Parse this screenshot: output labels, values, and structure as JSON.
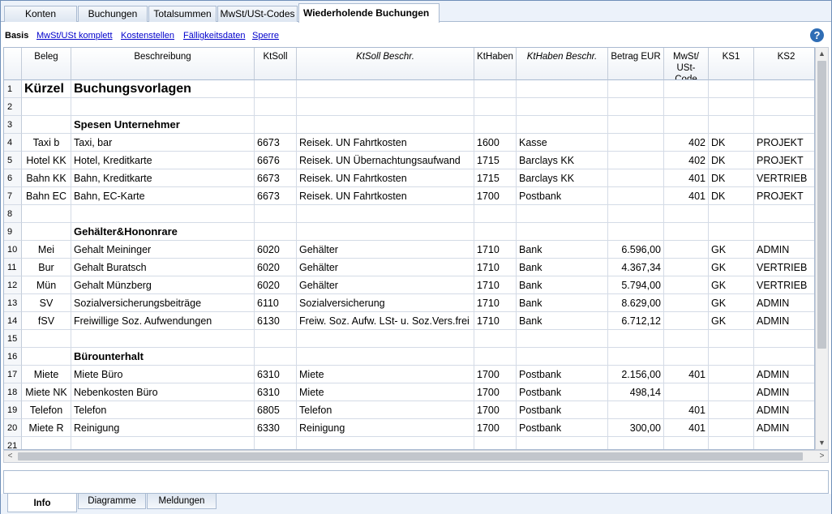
{
  "tabs": [
    {
      "label": "Konten",
      "active": false
    },
    {
      "label": "Buchungen",
      "active": false
    },
    {
      "label": "Totalsummen",
      "active": false
    },
    {
      "label": "MwSt/USt-Codes",
      "active": false
    },
    {
      "label": "Wiederholende Buchungen",
      "active": true,
      "close_glyph": "✕"
    }
  ],
  "views": [
    "Basis",
    "MwSt/USt komplett",
    "Kostenstellen",
    "Fälligkeitsdaten",
    "Sperre"
  ],
  "help_glyph": "?",
  "columns": [
    {
      "label": "Beleg",
      "italic": false
    },
    {
      "label": "Beschreibung",
      "italic": false
    },
    {
      "label": "KtSoll",
      "italic": false
    },
    {
      "label": "KtSoll Beschr.",
      "italic": true
    },
    {
      "label": "KtHaben",
      "italic": false
    },
    {
      "label": "KtHaben Beschr.",
      "italic": true
    },
    {
      "label": "Betrag EUR",
      "italic": false
    },
    {
      "label": "MwSt/\nUSt-Code",
      "italic": false
    },
    {
      "label": "KS1",
      "italic": false
    },
    {
      "label": "KS2",
      "italic": false
    }
  ],
  "rows": [
    {
      "n": "1",
      "type": "title",
      "cells": [
        "Kürzel",
        "Buchungsvorlagen",
        "",
        "",
        "",
        "",
        "",
        "",
        "",
        ""
      ]
    },
    {
      "n": "2",
      "type": "empty",
      "cells": [
        "",
        "",
        "",
        "",
        "",
        "",
        "",
        "",
        "",
        ""
      ]
    },
    {
      "n": "3",
      "type": "section",
      "cells": [
        "",
        "Spesen Unternehmer",
        "",
        "",
        "",
        "",
        "",
        "",
        "",
        ""
      ]
    },
    {
      "n": "4",
      "type": "data",
      "cells": [
        "Taxi b",
        "Taxi, bar",
        "6673",
        "Reisek. UN Fahrtkosten",
        "1600",
        "Kasse",
        "",
        "402",
        "DK",
        "PROJEKT"
      ]
    },
    {
      "n": "5",
      "type": "data",
      "cells": [
        "Hotel KK",
        "Hotel, Kreditkarte",
        "6676",
        "Reisek. UN Übernachtungsaufwand",
        "1715",
        "Barclays KK",
        "",
        "402",
        "DK",
        "PROJEKT"
      ]
    },
    {
      "n": "6",
      "type": "data",
      "cells": [
        "Bahn KK",
        "Bahn, Kreditkarte",
        "6673",
        "Reisek. UN Fahrtkosten",
        "1715",
        "Barclays KK",
        "",
        "401",
        "DK",
        "VERTRIEB"
      ]
    },
    {
      "n": "7",
      "type": "data",
      "cells": [
        "Bahn EC",
        "Bahn, EC-Karte",
        "6673",
        "Reisek. UN Fahrtkosten",
        "1700",
        "Postbank",
        "",
        "401",
        "DK",
        "PROJEKT"
      ]
    },
    {
      "n": "8",
      "type": "empty",
      "cells": [
        "",
        "",
        "",
        "",
        "",
        "",
        "",
        "",
        "",
        ""
      ]
    },
    {
      "n": "9",
      "type": "section",
      "cells": [
        "",
        "Gehälter&Hononrare",
        "",
        "",
        "",
        "",
        "",
        "",
        "",
        ""
      ]
    },
    {
      "n": "10",
      "type": "data",
      "cells": [
        "Mei",
        "Gehalt Meininger",
        "6020",
        "Gehälter",
        "1710",
        "Bank",
        "6.596,00",
        "",
        "GK",
        "ADMIN"
      ]
    },
    {
      "n": "11",
      "type": "data",
      "cells": [
        "Bur",
        "Gehalt Buratsch",
        "6020",
        "Gehälter",
        "1710",
        "Bank",
        "4.367,34",
        "",
        "GK",
        "VERTRIEB"
      ]
    },
    {
      "n": "12",
      "type": "data",
      "cells": [
        "Mün",
        "Gehalt Münzberg",
        "6020",
        "Gehälter",
        "1710",
        "Bank",
        "5.794,00",
        "",
        "GK",
        "VERTRIEB"
      ]
    },
    {
      "n": "13",
      "type": "data",
      "cells": [
        "SV",
        "Sozialversicherungsbeiträge",
        "6110",
        "Sozialversicherung",
        "1710",
        "Bank",
        "8.629,00",
        "",
        "GK",
        "ADMIN"
      ]
    },
    {
      "n": "14",
      "type": "data",
      "cells": [
        "fSV",
        "Freiwillige Soz. Aufwendungen",
        "6130",
        "Freiw. Soz. Aufw. LSt- u. Soz.Vers.frei",
        "1710",
        "Bank",
        "6.712,12",
        "",
        "GK",
        "ADMIN"
      ]
    },
    {
      "n": "15",
      "type": "empty",
      "cells": [
        "",
        "",
        "",
        "",
        "",
        "",
        "",
        "",
        "",
        ""
      ]
    },
    {
      "n": "16",
      "type": "section",
      "cells": [
        "",
        "Bürounterhalt",
        "",
        "",
        "",
        "",
        "",
        "",
        "",
        ""
      ]
    },
    {
      "n": "17",
      "type": "data",
      "cells": [
        "Miete",
        "Miete Büro",
        "6310",
        "Miete",
        "1700",
        "Postbank",
        "2.156,00",
        "401",
        "",
        "ADMIN"
      ]
    },
    {
      "n": "18",
      "type": "data",
      "cells": [
        "Miete NK",
        "Nebenkosten Büro",
        "6310",
        "Miete",
        "1700",
        "Postbank",
        "498,14",
        "",
        "",
        "ADMIN"
      ]
    },
    {
      "n": "19",
      "type": "data",
      "cells": [
        "Telefon",
        "Telefon",
        "6805",
        "Telefon",
        "1700",
        "Postbank",
        "",
        "401",
        "",
        "ADMIN"
      ]
    },
    {
      "n": "20",
      "type": "data",
      "cells": [
        "Miete R",
        "Reinigung",
        "6330",
        "Reinigung",
        "1700",
        "Postbank",
        "300,00",
        "401",
        "",
        "ADMIN"
      ]
    },
    {
      "n": "21",
      "type": "empty",
      "cells": [
        "",
        "",
        "",
        "",
        "",
        "",
        "",
        "",
        "",
        ""
      ]
    }
  ],
  "scroll_glyphs": {
    "up": "▲",
    "down": "▼",
    "left": "<",
    "right": ">"
  },
  "bottom_tabs": [
    {
      "label": "Info",
      "active": true
    },
    {
      "label": "Diagramme",
      "active": false
    },
    {
      "label": "Meldungen",
      "active": false
    }
  ]
}
